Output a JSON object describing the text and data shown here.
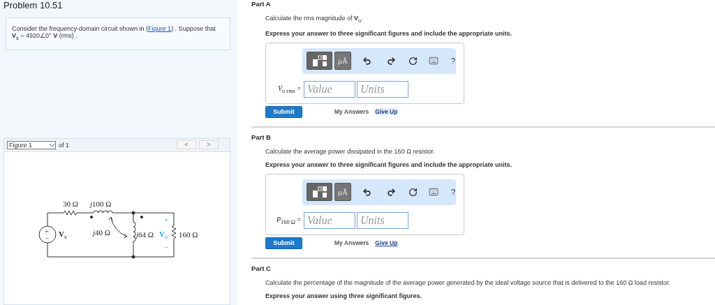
{
  "problem": {
    "title": "Problem 10.51",
    "intro_before": "Consider the frequency-domain circuit shown in (",
    "intro_link": "Figure 1",
    "intro_after": ") . Suppose that **V**$_{s}$ = 4920∠0° **V** (rms) ."
  },
  "figure": {
    "selector": "Figure 1",
    "count": "of 1",
    "prev": "<",
    "next": ">",
    "circuit": {
      "source_plus": "+",
      "source_minus": "−",
      "source_label": "**V**$_{s}$",
      "resistor_1": "30 Ω",
      "inductor_1": {
        "prefix": "j",
        "value": "100 Ω"
      },
      "mutual": {
        "prefix": "j",
        "value": "40 Ω"
      },
      "inductor_2": {
        "prefix": "j",
        "value": "64 Ω"
      },
      "output_plus": "+",
      "output_label": "**V**$_{o}$",
      "output_minus": "−",
      "resistor_2": "160 Ω"
    }
  },
  "parts": [
    {
      "label": "Part A",
      "question": "Calculate the rms magnitude of **V**$_{o}$.",
      "instruction": "Express your answer to three significant figures and include the appropriate units.",
      "answer": {
        "units_button": "μÅ",
        "help": "?",
        "variable": "*V*$_{o rms}$ =",
        "value_placeholder": "Value",
        "units_placeholder": "Units"
      },
      "submit": "Submit",
      "my_answers": "My Answers",
      "give_up": {
        "label": "Give Up",
        "hovered": true
      }
    },
    {
      "label": "Part B",
      "question": "Calculate the average power dissipated in the 160 Ω resistor.",
      "instruction": "Express your answer to three significant figures and include the appropriate units.",
      "answer": {
        "units_button": "μÅ",
        "help": "?",
        "variable": "*P*$_{160 Ω}$ =",
        "value_placeholder": "Value",
        "units_placeholder": "Units"
      },
      "submit": "Submit",
      "my_answers": "My Answers",
      "give_up": {
        "label": "Give Up",
        "hovered": false
      }
    },
    {
      "label": "Part C",
      "question": "Calculate the percentage of the magnitude of the average power generated by the ideal voltage source that is delivered to the 160 Ω load resistor.",
      "instruction": "Express your answer using three significant figures."
    }
  ]
}
